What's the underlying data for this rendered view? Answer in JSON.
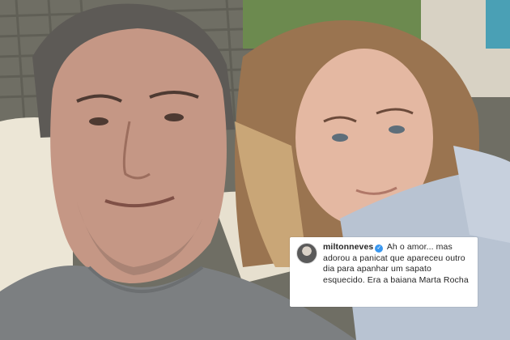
{
  "comment": {
    "username": "miltonneves",
    "verified_icon": "verified-badge-icon",
    "text": "Ah o amor... mas adorou a panicat que apareceu outro dia para apanhar um sapato esquecido. Era a baiana Marta Rocha"
  },
  "colors": {
    "verified": "#3897f0",
    "comment_bg": "#ffffff",
    "text": "#262626"
  }
}
